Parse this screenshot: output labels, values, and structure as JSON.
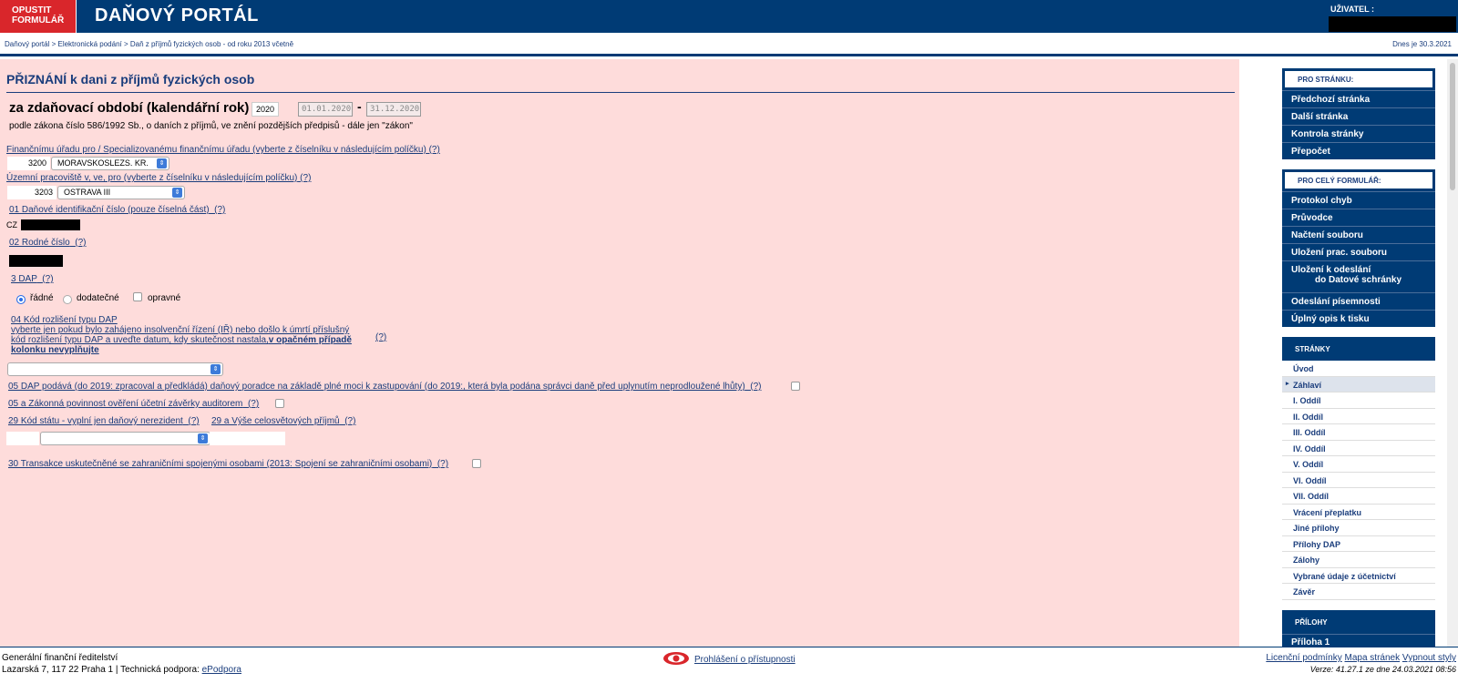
{
  "header": {
    "exit_line1": "OPUSTIT",
    "exit_line2": "FORMULÁŘ",
    "title": "DAŇOVÝ PORTÁL",
    "user_label": "UŽIVATEL :"
  },
  "breadcrumb": {
    "path": "Daňový portál > Elektronická podání > Daň z příjmů fyzických osob - od roku 2013 včetně",
    "date": "Dnes je 30.3.2021"
  },
  "form": {
    "title": "PŘIZNÁNÍ k dani z příjmů fyzických osob",
    "period_label": "za zdaňovací období (kalendářní rok)",
    "year": "2020",
    "date_from": "01.01.2020",
    "date_to": "31.12.2020",
    "law": "podle zákona číslo 586/1992 Sb., o daních z příjmů, ve znění pozdějších předpisů - dále jen \"zákon\"",
    "help": "(?)",
    "office_label": "Finančnímu úřadu pro / Specializovanému finančnímu úřadu (vyberte z číselníku v následujícím políčku)",
    "office_code": "3200",
    "office_value": "MORAVSKOSLEZS. KR.",
    "workplace_label": "Územní pracoviště v, ve, pro (vyberte z číselníku v následujícím políčku)",
    "workplace_code": "3203",
    "workplace_value": "OSTRAVA III",
    "dic_label": "01 Daňové identifikační číslo (pouze číselná část)",
    "dic_prefix": "CZ",
    "rc_label": "02 Rodné číslo",
    "dap_label": "3 DAP",
    "dap_options": [
      "řádné",
      "dodatečné",
      "opravné"
    ],
    "kod_label_1": "04 Kód rozlišení typu DAP",
    "kod_label_2": "vyberte jen pokud bylo zahájeno insolvenční řízení (IŘ) nebo došlo k úmrtí příslušný",
    "kod_label_3": "kód rozlišení typu DAP a uveďte datum, kdy skutečnost nastala,",
    "kod_label_3b": "v opačném případě",
    "kod_label_4": "kolonku nevyplňujte",
    "advisor_label": "05 DAP podává (do 2019: zpracoval a předkládá) daňový poradce na základě plné moci k zastupování (do 2019:, která byla podána správci daně před uplynutím neprodloužené lhůty)",
    "audit_label": "05 a Zákonná povinnost ověření účetní závěrky auditorem",
    "state_label": "29 Kód státu - vyplní jen daňový nerezident",
    "income_label": "29 a Výše celosvětových příjmů",
    "transaction_label": "30 Transakce uskutečněné se zahraničními spojenými osobami (2013: Spojení se zahraničními osobami)"
  },
  "sidebar": {
    "page_header": "PRO STRÁNKU:",
    "page_buttons": [
      "Předchozí stránka",
      "Další stránka",
      "Kontrola stránky",
      "Přepočet"
    ],
    "form_header": "PRO CELÝ FORMULÁŘ:",
    "form_buttons": [
      "Protokol chyb",
      "Průvodce",
      "Načtení souboru",
      "Uložení prac. souboru"
    ],
    "send_line1": "Uložení k odeslání",
    "send_line2": "do Datové schránky",
    "form_buttons_2": [
      "Odeslání písemnosti",
      "Úplný opis k tisku"
    ],
    "pages_header": "STRÁNKY",
    "pages": [
      "Úvod",
      "Záhlaví",
      "I. Oddíl",
      "II. Oddíl",
      "III. Oddíl",
      "IV. Oddíl",
      "V. Oddíl",
      "VI. Oddíl",
      "VII. Oddíl",
      "Vrácení přeplatku",
      "Jiné přílohy",
      "Přílohy DAP",
      "Zálohy",
      "Vybrané údaje z účetnictví",
      "Závěr"
    ],
    "active_page": "Záhlaví",
    "attachments_header": "PŘÍLOHY",
    "attachments": [
      "Příloha 1"
    ]
  },
  "footer": {
    "org": "Generální finanční ředitelství",
    "address": "Lazarská 7, 117 22 Praha 1 | Technická podpora:",
    "support_link": "ePodpora",
    "accessibility": "Prohlášení o přístupnosti",
    "license": "Licenční podmínky",
    "sitemap": "Mapa stránek",
    "styles": "Vypnout styly",
    "version": "Verze: 41.27.1 ze dne 24.03.2021 08:56"
  },
  "colors": {
    "brand_blue": "#003b75",
    "exit_red": "#d9262b",
    "form_bg": "#fedcdb"
  }
}
